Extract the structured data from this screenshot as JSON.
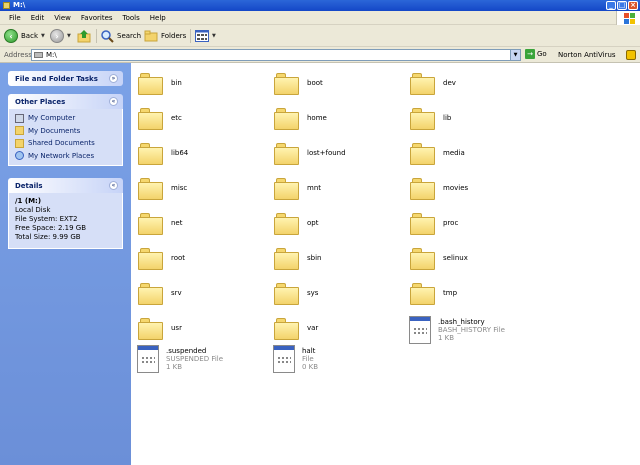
{
  "window": {
    "title": "M:\\"
  },
  "menu": [
    "File",
    "Edit",
    "View",
    "Favorites",
    "Tools",
    "Help"
  ],
  "toolbar": {
    "back_label": "Back",
    "search_label": "Search",
    "folders_label": "Folders"
  },
  "address": {
    "label": "Address",
    "value": "M:\\",
    "go_label": "Go",
    "norton_label": "Norton AntiVirus"
  },
  "left_pane": {
    "tasks_title": "File and Folder Tasks",
    "other_places_title": "Other Places",
    "other_places": [
      "My Computer",
      "My Documents",
      "Shared Documents",
      "My Network Places"
    ],
    "details_title": "Details",
    "details": {
      "name": "/1 (M:)",
      "type": "Local Disk",
      "filesystem": "File System: EXT2",
      "free": "Free Space: 2.19 GB",
      "total": "Total Size: 9.99 GB"
    }
  },
  "folders": [
    "bin",
    "boot",
    "dev",
    "etc",
    "home",
    "lib",
    "lib64",
    "lost+found",
    "media",
    "misc",
    "mnt",
    "movies",
    "net",
    "opt",
    "proc",
    "root",
    "sbin",
    "selinux",
    "srv",
    "sys",
    "tmp",
    "usr",
    "var"
  ],
  "files": [
    {
      "name": ".bash_history",
      "type": "BASH_HISTORY File",
      "size": "1 KB"
    },
    {
      "name": ".suspended",
      "type": "SUSPENDED File",
      "size": "1 KB"
    },
    {
      "name": "halt",
      "type": "File",
      "size": "0 KB"
    }
  ]
}
